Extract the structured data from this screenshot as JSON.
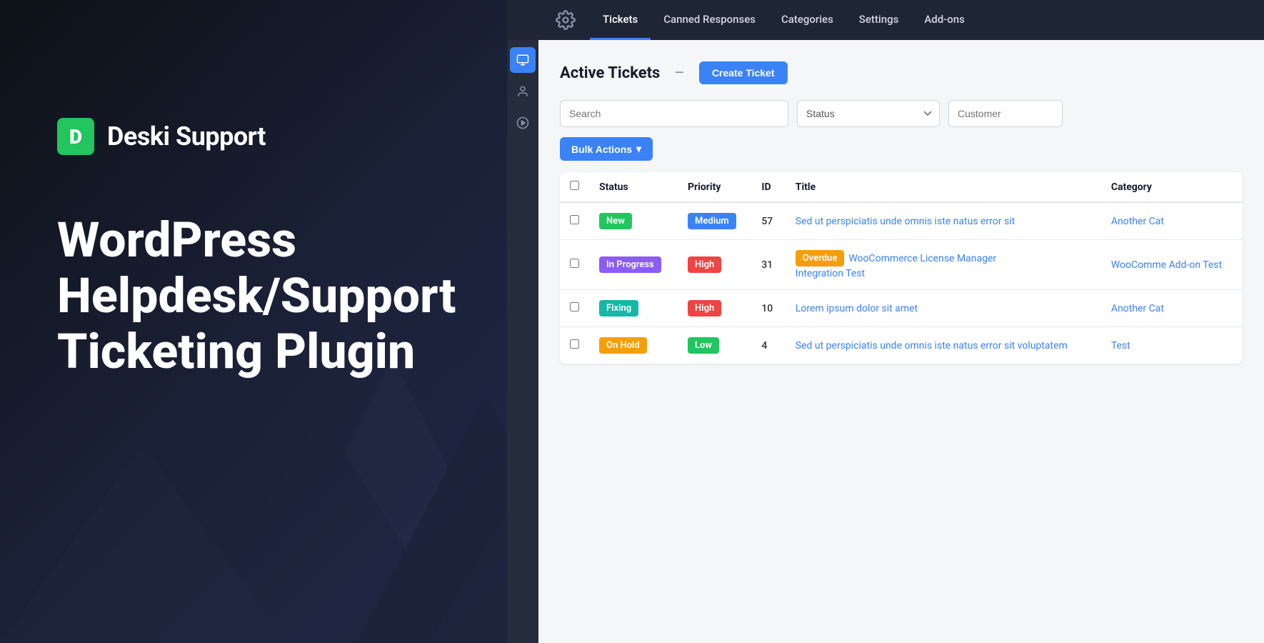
{
  "brand": {
    "logo_letter": "D",
    "name": "Deski Support"
  },
  "hero": {
    "line1": "WordPress",
    "line2": "Helpdesk/Support",
    "line3": "Ticketing Plugin"
  },
  "nav": {
    "items": [
      {
        "label": "Tickets",
        "active": true
      },
      {
        "label": "Canned Responses",
        "active": false
      },
      {
        "label": "Categories",
        "active": false
      },
      {
        "label": "Settings",
        "active": false
      },
      {
        "label": "Add-ons",
        "active": false
      }
    ]
  },
  "toolbar": {
    "page_title": "Active Tickets",
    "dash": "–",
    "create_ticket_label": "Create Ticket",
    "search_placeholder": "Search",
    "status_label": "Status",
    "customer_placeholder": "Customer",
    "bulk_actions_label": "Bulk Actions"
  },
  "table": {
    "columns": [
      "",
      "Status",
      "Priority",
      "ID",
      "Title",
      "Category"
    ],
    "rows": [
      {
        "id": "57",
        "status": "New",
        "status_type": "new",
        "priority": "Medium",
        "priority_type": "medium",
        "title": "Sed ut perspiciatis unde omnis iste natus error sit",
        "title_extra": null,
        "category": "Another Cat",
        "overdue": false
      },
      {
        "id": "31",
        "status": "In Progress",
        "status_type": "in-progress",
        "priority": "High",
        "priority_type": "high",
        "title": "WooCommerce License Manager Integration Test",
        "title_extra": null,
        "category": "WooComme Add-on Test",
        "overdue": true,
        "overdue_label": "Overdue"
      },
      {
        "id": "10",
        "status": "Fixing",
        "status_type": "fixing",
        "priority": "High",
        "priority_type": "high",
        "title": "Lorem ipsum dolor sit amet",
        "title_extra": null,
        "category": "Another Cat",
        "overdue": false
      },
      {
        "id": "4",
        "status": "On Hold",
        "status_type": "on-hold",
        "priority": "Low",
        "priority_type": "low",
        "title": "Sed ut perspiciatis unde omnis iste natus error sit voluptatem",
        "title_extra": null,
        "category": "Test",
        "overdue": false
      }
    ]
  },
  "colors": {
    "brand_green": "#22c55e",
    "brand_blue": "#3b82f6",
    "nav_bg": "#1e2535",
    "sidebar_bg": "#252d3d"
  }
}
